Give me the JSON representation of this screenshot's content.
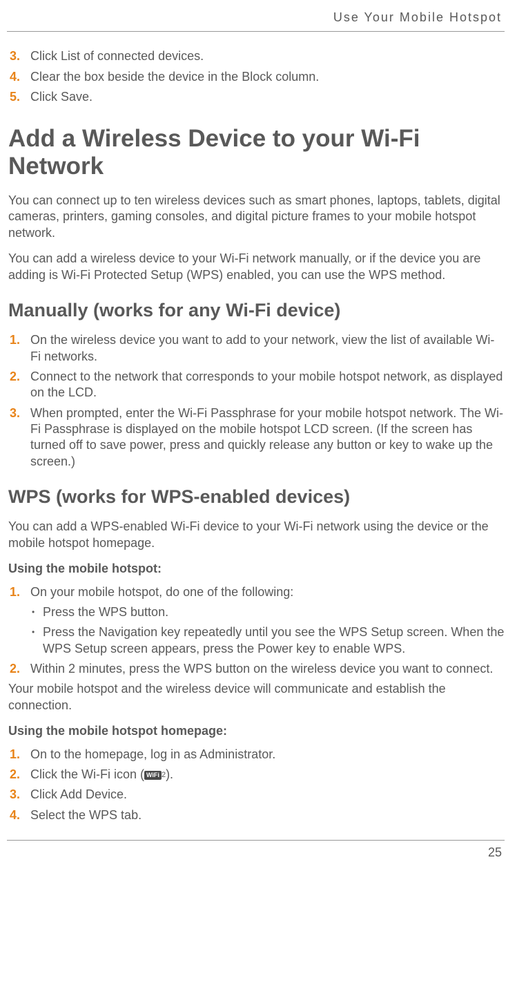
{
  "header": {
    "title": "Use Your Mobile Hotspot"
  },
  "intro_steps": [
    {
      "num": "3.",
      "text": "Click List of connected devices."
    },
    {
      "num": "4.",
      "text": "Clear the box beside the device in the Block column."
    },
    {
      "num": "5.",
      "text": "Click Save."
    }
  ],
  "h1": "Add a Wireless Device to your Wi-Fi Network",
  "p1": "You can connect up to ten wireless devices such as smart phones, laptops, tablets, digital cameras, printers, gaming consoles, and digital picture frames to your mobile hotspot network.",
  "p2": "You can add a wireless device to your Wi-Fi network manually, or if the device you are adding is Wi-Fi Protected Setup (WPS) enabled, you can use the WPS method.",
  "h2a": "Manually (works for any Wi-Fi device)",
  "manual_steps": [
    {
      "num": "1.",
      "text": "On the wireless device you want to add to your network, view the list of available Wi-Fi networks."
    },
    {
      "num": "2.",
      "text": "Connect to the network that corresponds to your mobile hotspot network, as displayed on the LCD."
    },
    {
      "num": "3.",
      "text": "When prompted, enter the Wi-Fi Passphrase for your mobile hotspot network. The Wi-Fi Passphrase is displayed on the mobile hotspot LCD screen. (If the screen has turned off to save power, press and quickly release any button or key to wake up the screen.)"
    }
  ],
  "h2b": "WPS (works for WPS-enabled devices)",
  "p3": "You can add a WPS-enabled Wi-Fi device to your Wi-Fi network using the device or the mobile hotspot homepage.",
  "bold1": "Using the mobile hotspot:",
  "wps_hotspot_steps": {
    "step1": {
      "num": "1.",
      "text": "On your mobile hotspot, do one of the following:"
    },
    "bullets": [
      "Press the WPS button.",
      "Press the Navigation key repeatedly until you see the WPS Setup screen. When the WPS Setup screen appears, press the Power key to enable WPS."
    ],
    "step2": {
      "num": "2.",
      "text": "Within 2 minutes, press the WPS button on the wireless device you want to connect."
    }
  },
  "p4": "Your mobile hotspot and the wireless device will communicate and establish the connection.",
  "bold2": "Using the mobile hotspot homepage:",
  "homepage_steps": [
    {
      "num": "1.",
      "text": "On to the homepage, log in as Administrator."
    },
    {
      "num": "2.",
      "pre": "Click the Wi-Fi icon (",
      "icon": "WiFi",
      "sup": "2",
      "post": ")."
    },
    {
      "num": "3.",
      "text": "Click Add Device."
    },
    {
      "num": "4.",
      "text": "Select the WPS tab."
    }
  ],
  "page_number": "25"
}
